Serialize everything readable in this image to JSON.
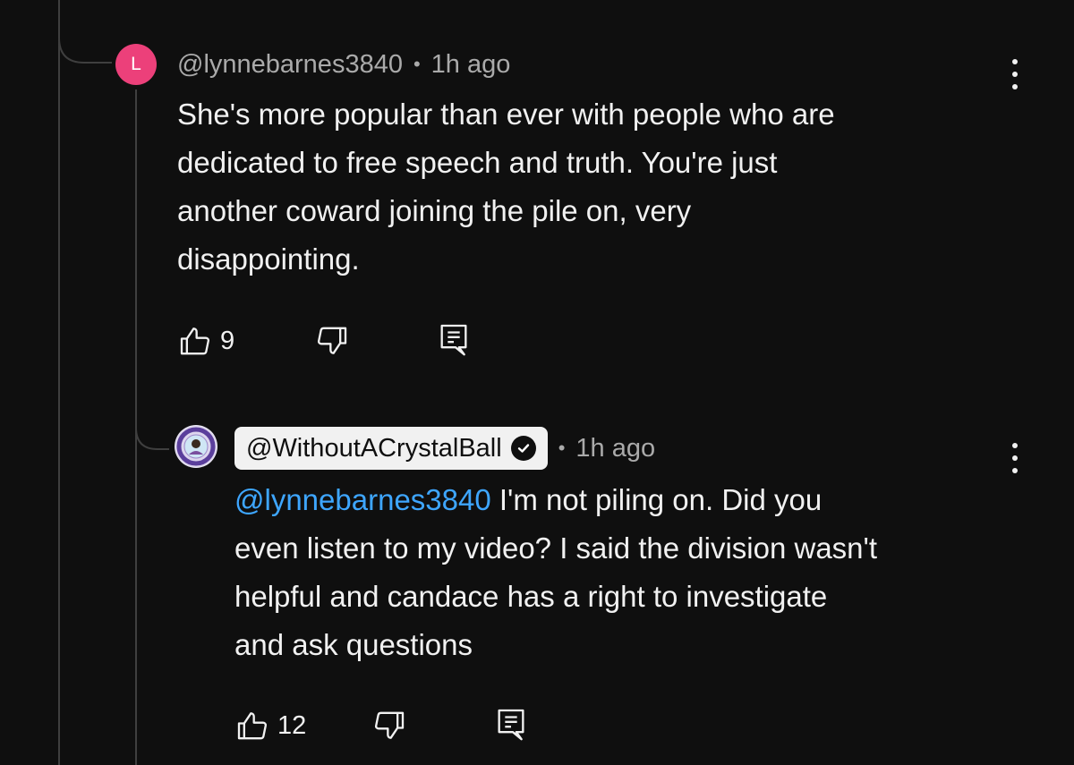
{
  "comments": [
    {
      "avatar_letter": "L",
      "avatar_color": "#ec407a",
      "author": "@lynnebarnes3840",
      "separator": "•",
      "timestamp": "1h ago",
      "text": "She's more popular than ever with people who are\ndedicated to free speech and truth. You're just\nanother coward joining the pile on, very\ndisappointing.",
      "like_count": "9"
    },
    {
      "avatar_icon": "channel-logo",
      "author": "@WithoutACrystalBall",
      "verified": true,
      "separator": "•",
      "timestamp": "1h ago",
      "mention": "@lynnebarnes3840",
      "text": " I'm not piling on. Did you\neven listen to my video? I said the division wasn't\nhelpful and candace has a right to investigate\nand ask questions",
      "like_count": "12"
    }
  ],
  "colors": {
    "background": "#0f0f0f",
    "text": "#f1f1f1",
    "secondary_text": "#aaaaaa",
    "mention": "#3ea6ff",
    "thread_line": "#3f3f3f"
  }
}
